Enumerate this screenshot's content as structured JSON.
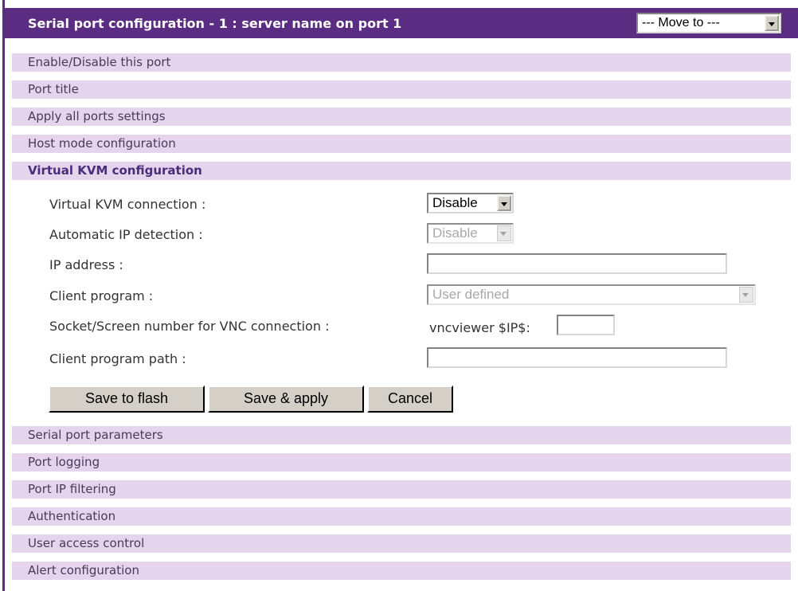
{
  "header": {
    "title": "Serial port configuration - 1 : server name on port 1",
    "move_to": "--- Move to ---"
  },
  "sections_top": [
    {
      "label": "Enable/Disable this port"
    },
    {
      "label": "Port title"
    },
    {
      "label": "Apply all ports settings"
    },
    {
      "label": "Host mode configuration"
    },
    {
      "label": "Virtual KVM configuration"
    }
  ],
  "kvm": {
    "connection_label": "Virtual KVM connection :",
    "connection_value": "Disable",
    "auto_ip_label": "Automatic IP detection :",
    "auto_ip_value": "Disable",
    "ip_label": "IP address :",
    "ip_value": "",
    "client_program_label": "Client program :",
    "client_program_value": "User defined",
    "socket_label": "Socket/Screen number for VNC connection :",
    "socket_prefix": "vncviewer $IP$:",
    "socket_value": "",
    "path_label": "Client program path :",
    "path_value": ""
  },
  "buttons": {
    "save_flash": "Save to flash",
    "save_apply": "Save & apply",
    "cancel": "Cancel"
  },
  "sections_bottom": [
    {
      "label": "Serial port parameters"
    },
    {
      "label": "Port logging"
    },
    {
      "label": "Port IP filtering"
    },
    {
      "label": "Authentication"
    },
    {
      "label": "User access control"
    },
    {
      "label": "Alert configuration"
    }
  ],
  "colors": {
    "header_bg": "#5a2d82",
    "section_bg": "#e4d4ec"
  }
}
